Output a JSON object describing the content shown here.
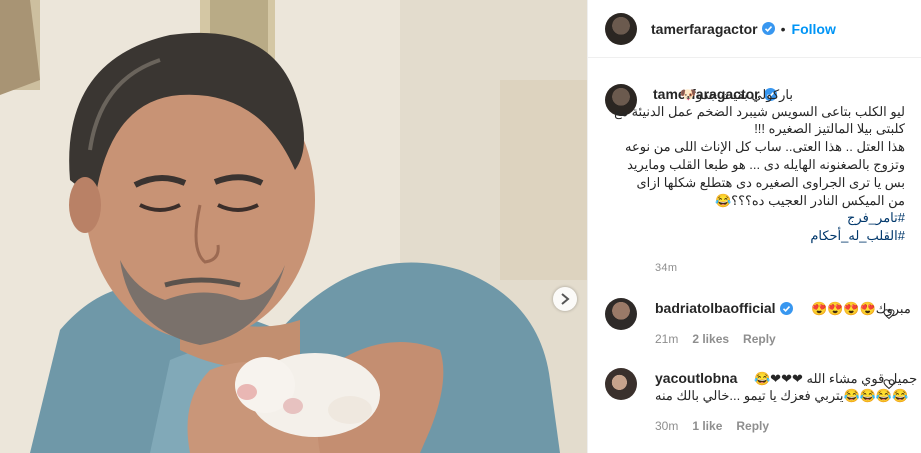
{
  "post": {
    "username": "tamerfaragactor",
    "follow_label": "Follow",
    "dot": "•",
    "caption_lines": [
      "باركولي بقيت جدو🐶",
      "ليو الكلب بتاعى السويس شيبرد الضخم عمل الدنيئة مع",
      "كلبتى بيلا المالتيز الصغيره !!!",
      "هذا العتل .. هذا العتى.. ساب كل الإناث اللى من نوعه",
      "وتزوج بالصغنونه الهايله دى ... هو طبعا القلب ومايريد",
      "بس يا ترى الجراوى الصغيره دى هتطلع شكلها ازاى",
      "من الميكس النادر العجيب ده؟؟؟😂"
    ],
    "hashtags": [
      "#تامر_فرج",
      "#القلب_له_أحكام"
    ],
    "time": "34m"
  },
  "comments": [
    {
      "username": "badriatolbaofficial",
      "text": "مبروك😍😍😍😍",
      "time": "21m",
      "likes": "2 likes",
      "reply": "Reply"
    },
    {
      "username": "yacoutlobna",
      "text_line1": "جميل قوي مشاء الله ❤❤❤😂",
      "text_line2": "😂😂😂😂يتربي فعزك يا تيمو ...خالي بالك منه",
      "time": "30m",
      "likes": "1 like",
      "reply": "Reply"
    }
  ],
  "icons": {
    "verified": "verified-badge-icon",
    "next": "chevron-right-icon",
    "heart": "heart-outline-icon"
  },
  "colors": {
    "accent": "#0095f6",
    "verified": "#3897f0",
    "hashtag": "#00376b",
    "meta": "#8e8e8e"
  }
}
